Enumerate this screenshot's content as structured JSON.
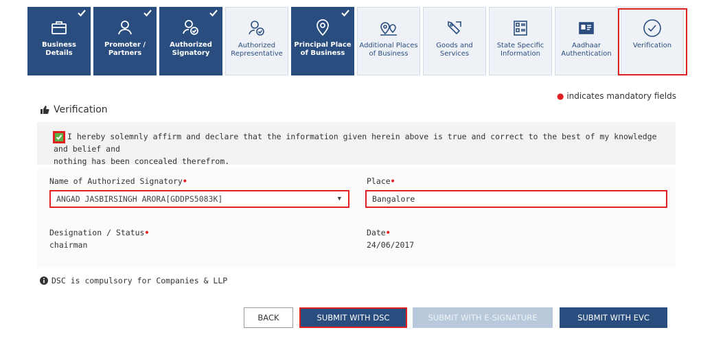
{
  "tabs": [
    {
      "label": "Business Details",
      "icon": "briefcase-icon",
      "state": "done"
    },
    {
      "label": "Promoter / Partners",
      "icon": "person-icon",
      "state": "done"
    },
    {
      "label": "Authorized Signatory",
      "icon": "person-check-icon",
      "state": "done"
    },
    {
      "label": "Authorized Representative",
      "icon": "person-check-icon",
      "state": "todo"
    },
    {
      "label": "Principal Place of Business",
      "icon": "location-pin-icon",
      "state": "done"
    },
    {
      "label": "Additional Places of Business",
      "icon": "multi-location-icon",
      "state": "todo"
    },
    {
      "label": "Goods and Services",
      "icon": "tag-icon",
      "state": "todo"
    },
    {
      "label": "State Specific Information",
      "icon": "document-grid-icon",
      "state": "todo"
    },
    {
      "label": "Aadhaar Authentication",
      "icon": "id-card-icon",
      "state": "todo"
    },
    {
      "label": "Verification",
      "icon": "check-circle-icon",
      "state": "current"
    }
  ],
  "mandatory_note": "indicates mandatory fields",
  "section_title": "Verification",
  "declaration_line1": "I hereby solemnly affirm and declare that the information given herein above is true and correct to the best of my knowledge and belief and",
  "declaration_line2": "nothing has been concealed therefrom.",
  "declaration_checked": true,
  "fields": {
    "signatory_label": "Name of Authorized Signatory",
    "signatory_value": "ANGAD JASBIRSINGH ARORA[GDDPS5083K]",
    "place_label": "Place",
    "place_value": "Bangalore",
    "designation_label": "Designation / Status",
    "designation_value": "chairman",
    "date_label": "Date",
    "date_value": "24/06/2017"
  },
  "dsc_note": "DSC is compulsory for Companies & LLP",
  "buttons": {
    "back": "BACK",
    "submit_dsc": "SUBMIT WITH DSC",
    "submit_esign": "SUBMIT WITH E-SIGNATURE",
    "submit_evc": "SUBMIT WITH EVC"
  },
  "colors": {
    "primary": "#2a4d7f",
    "highlight": "#e02020",
    "checkbox": "#5bb146",
    "disabled": "#b9c8da"
  }
}
